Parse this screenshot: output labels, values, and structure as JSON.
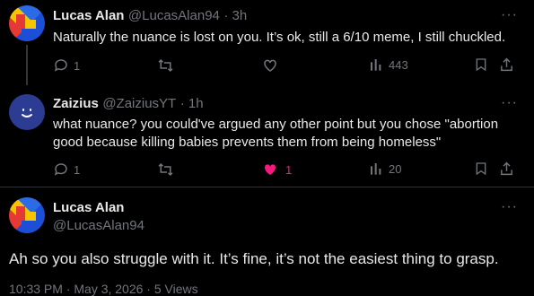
{
  "tweets": [
    {
      "author_name": "Lucas Alan",
      "handle": "@LucasAlan94",
      "time": "· 3h",
      "text": "Naturally the nuance is lost on you. It’s ok, still a 6/10 meme, I still chuckled.",
      "reply_count": "1",
      "like_count": "",
      "view_count": "443"
    },
    {
      "author_name": "Zaizius",
      "handle": "@ZaiziusYT",
      "time": "· 1h",
      "text_line1": "what nuance? you could've argued any other point but you chose \"abortion",
      "text_line2": "good because killing babies prevents them from being homeless\"",
      "reply_count": "1",
      "like_count": "1",
      "view_count": "20",
      "liked": true
    }
  ],
  "main_tweet": {
    "author_name": "Lucas Alan",
    "handle": "@LucasAlan94",
    "text": "Ah so you also struggle with it. It’s fine, it’s not the easiest thing to grasp.",
    "footer_partial": "10:33 PM · May 3, 2026 · 5 Views"
  },
  "more_symbol": "···",
  "colors": {
    "background": "#000000",
    "text": "#e7e9ea",
    "muted": "#71767b",
    "like_pink": "#f91880",
    "zaizius_avatar": "#2c3c93"
  },
  "icons": [
    "reply-icon",
    "retweet-icon",
    "like-icon",
    "views-icon",
    "bookmark-icon",
    "share-icon",
    "more-icon"
  ]
}
